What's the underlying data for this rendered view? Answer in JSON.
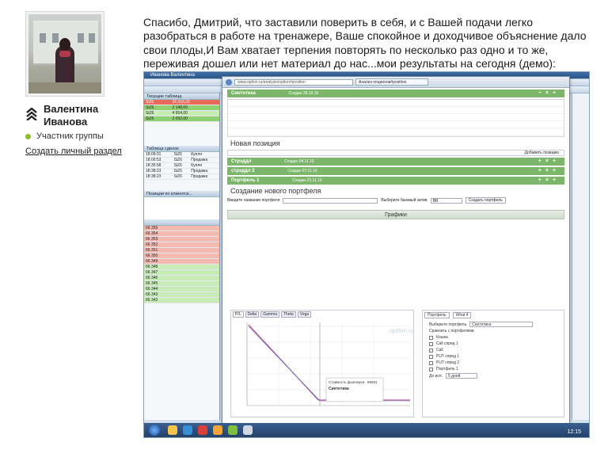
{
  "author": {
    "name_line1": "Валентина",
    "name_line2": "Иванова",
    "rank_icon": "chevron-rank-icon",
    "group_label": "Участник группы",
    "group_dot_color": "#8bbf2f",
    "create_section_link": "Создать личный раздел"
  },
  "post": {
    "text": "Спасибо, Дмитрий, что заставили поверить в себя, и с Вашей подачи легко разобраться в работе на тренажере, Ваше спокойное и доходчивое объяснение дало свои плоды,И Вам хватает терпения повторять по несколько раз одно и то же, переживая дошел или нет материал до нас...мои результаты на сегодня (демо):"
  },
  "screenshot": {
    "window_title": "Иванова Валентина",
    "panels": {
      "current_table": "Текущие таблица",
      "deals_table": "Таблица сделок",
      "positions": "Позиции по клиентск..."
    },
    "left_rows": [
      {
        "a": "SiZ6",
        "b": "15 316,23",
        "style": "red"
      },
      {
        "a": "SiZ6",
        "b": "2 148,00",
        "style": "grn"
      },
      {
        "a": "SiZ6",
        "b": "4 654,00",
        "style": "lgrn"
      },
      {
        "a": "SiZ6",
        "b": "2 092,00",
        "style": "grn"
      }
    ],
    "deals": [
      {
        "t": "18:09:31",
        "s": "SiZ6",
        "op": "Купля"
      },
      {
        "t": "18:09:53",
        "s": "SiZ6",
        "op": "Продажа"
      },
      {
        "t": "18:35:58",
        "s": "SiZ6",
        "op": "Купля"
      },
      {
        "t": "18:38:23",
        "s": "SiZ6",
        "op": "Продажа"
      },
      {
        "t": "18:38:23",
        "s": "SiZ6",
        "op": "Продажа"
      }
    ],
    "orderbook": [
      "66 355",
      "66 354",
      "66 353",
      "66 352",
      "66 351",
      "66 350",
      "66 349",
      "66 348",
      "66 347",
      "66 346",
      "66 345",
      "66 344",
      "66 343",
      "66 342"
    ],
    "browser": {
      "url": "www.option.ru/analysis/option#position",
      "tab_title": "Анализ опционов#position",
      "sections": [
        {
          "title": "Синтетика",
          "sub": "Создан 28.10.16"
        },
        {
          "title": "Стрэддл",
          "sub": "Создан 04.11.16"
        },
        {
          "title": "стрэддл 2",
          "sub": "Создан 07.11.16"
        },
        {
          "title": "Портфель 1",
          "sub": "Создан 22.11.16"
        }
      ],
      "new_position": "Новая позиция",
      "new_portfolio": "Создание нового портфеля",
      "portfolio_name_placeholder": "Введите название портфеля",
      "base_asset_label": "Выберите базовый актив",
      "base_asset_value": "BR",
      "create_portfolio_btn": "Создать портфель",
      "add_position_btn": "Добавить позицию",
      "graphs_title": "Графики",
      "chart_tabs": [
        "P/L",
        "Delta",
        "Gamma",
        "Theta",
        "Vega"
      ],
      "side_tabs": [
        "Портфель",
        "What if"
      ],
      "side_label": "Выберите портфель",
      "side_value": "Синтетика",
      "compare_label": "Сравнить с портфелями",
      "compare_items": [
        "Кошка",
        "Call спред 1",
        "Call",
        "PUT спред 1",
        "PUT спред 2",
        "Портфель 1"
      ],
      "date_label": "До исп.",
      "date_value": "5 дней",
      "tooltip_title": "Синтетика",
      "tooltip_cost_label": "Стоимость фьючерса",
      "tooltip_cost": "65931",
      "watermark": "option.ru"
    },
    "clock": "12:15"
  }
}
